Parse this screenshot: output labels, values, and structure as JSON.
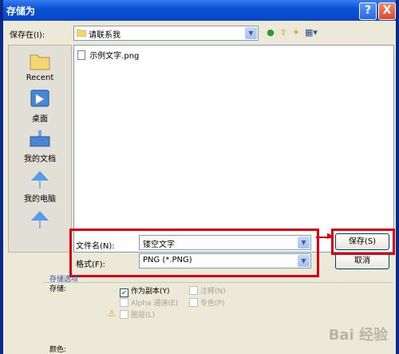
{
  "window": {
    "title": "存储为",
    "help_label": "?",
    "close_label": "X"
  },
  "save_in": {
    "label": "保存在(I):",
    "value": "请联系我"
  },
  "places": [
    {
      "label": "Recent",
      "icon": "recent-folder-icon"
    },
    {
      "label": "桌面",
      "icon": "desktop-icon"
    },
    {
      "label": "我的文档",
      "icon": "my-documents-icon"
    },
    {
      "label": "我的电脑",
      "icon": "my-computer-icon"
    },
    {
      "label": "",
      "icon": "network-icon"
    }
  ],
  "files": [
    {
      "name": "示例文字.png"
    }
  ],
  "filename": {
    "label": "文件名(N):",
    "value": "镂空文字"
  },
  "format": {
    "label": "格式(F):",
    "value": "PNG (*.PNG)"
  },
  "buttons": {
    "save": "保存(S)",
    "cancel": "取消"
  },
  "options": {
    "section_title": "存储选项",
    "storage_label": "存储:",
    "as_copy": "作为副本(Y)",
    "annotations": "注释(N)",
    "alpha": "Alpha 通道(E)",
    "spot": "专色(P)",
    "layers": "图层(L)",
    "color_label": "颜色:"
  },
  "watermark": "Bai 经验",
  "colors": {
    "highlight": "#e00010",
    "titlebar": "#0a54d8"
  }
}
